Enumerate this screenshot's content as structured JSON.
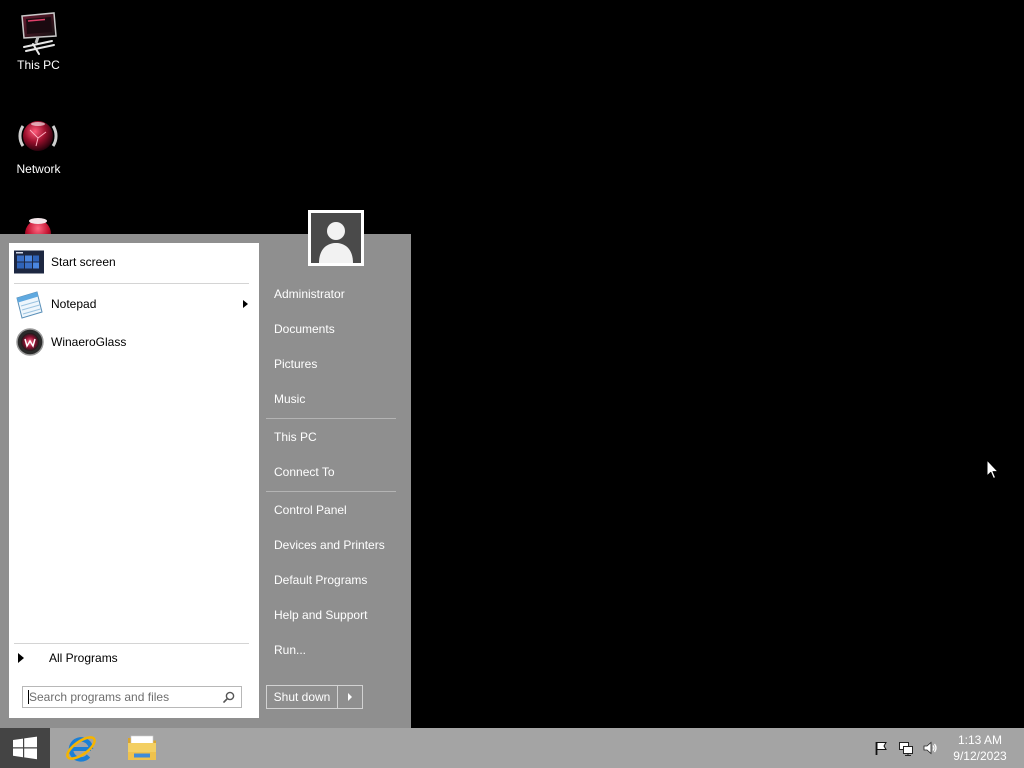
{
  "desktop": {
    "icons": [
      {
        "label": "This PC",
        "icon": "this-pc-icon"
      },
      {
        "label": "Network",
        "icon": "network-icon"
      },
      {
        "icon": "recycle-bin-icon"
      }
    ]
  },
  "start_menu": {
    "user_picture_icon": "user-avatar-icon",
    "programs": [
      {
        "label": "Start screen",
        "icon": "start-screen-icon"
      },
      {
        "label": "Notepad",
        "icon": "notepad-icon",
        "has_submenu": true
      },
      {
        "label": "WinaeroGlass",
        "icon": "winaeroglass-icon"
      }
    ],
    "all_programs": {
      "label": "All Programs",
      "icon": "expand-arrow-icon"
    },
    "search": {
      "placeholder": "Search programs and files",
      "icon": "search-icon"
    },
    "places_groups": [
      {
        "items": [
          {
            "label": "Administrator"
          },
          {
            "label": "Documents"
          },
          {
            "label": "Pictures"
          },
          {
            "label": "Music"
          }
        ]
      },
      {
        "items": [
          {
            "label": "This PC"
          },
          {
            "label": "Connect To"
          }
        ]
      },
      {
        "items": [
          {
            "label": "Control Panel"
          },
          {
            "label": "Devices and Printers"
          },
          {
            "label": "Default Programs"
          },
          {
            "label": "Help and Support"
          },
          {
            "label": "Run..."
          }
        ]
      }
    ],
    "shutdown": {
      "label": "Shut down",
      "options_icon": "chevron-right-icon"
    }
  },
  "taskbar": {
    "start_icon": "windows-logo-icon",
    "pinned": [
      {
        "icon": "internet-explorer-icon"
      },
      {
        "icon": "file-explorer-icon"
      }
    ],
    "tray": {
      "icons": [
        "action-center-flag-icon",
        "network-icon",
        "volume-icon"
      ],
      "time": "1:13 AM",
      "date": "9/12/2023"
    }
  },
  "cursor_icon": "mouse-cursor-icon",
  "colors": {
    "desktop_background": "#000000",
    "menu_frame": "#8f8f8f",
    "menu_left_panel": "#ffffff",
    "taskbar": "#a4a4a4",
    "start_button_active": "#444444"
  }
}
